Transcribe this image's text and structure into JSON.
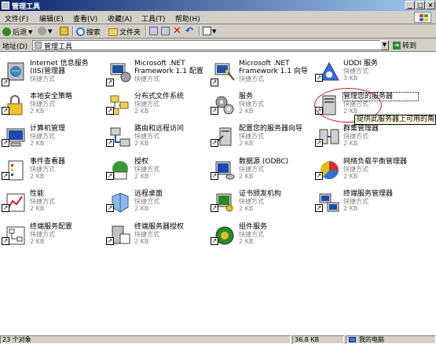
{
  "window": {
    "title": "管理工具"
  },
  "title_buttons": {
    "minimize": "_",
    "maximize": "□",
    "close": "×"
  },
  "menu": [
    {
      "label": "文件(F)"
    },
    {
      "label": "编辑(E)"
    },
    {
      "label": "查看(V)"
    },
    {
      "label": "收藏(A)"
    },
    {
      "label": "工具(T)"
    },
    {
      "label": "帮助(H)"
    }
  ],
  "toolbar": {
    "back": "后退",
    "search": "搜索",
    "folders": "文件夹"
  },
  "address": {
    "label": "地址(D)",
    "value": "管理工具",
    "go": "转到"
  },
  "items": [
    {
      "name": "Internet 信息服务\n(IIS)管理器",
      "sub1": "快捷方式",
      "sub2": "",
      "icon": "iis-icon"
    },
    {
      "name": "Microsoft .NET\nFramework 1.1 配置",
      "sub1": "快捷方式",
      "sub2": "",
      "icon": "net-config-icon"
    },
    {
      "name": "Microsoft .NET\nFramework 1.1 向导",
      "sub1": "快捷方式",
      "sub2": "",
      "icon": "net-wizard-icon"
    },
    {
      "name": "UDDI 服务",
      "sub1": "快捷方式",
      "sub2": "3 KB",
      "icon": "uddi-icon"
    },
    {
      "name": "本地安全策略",
      "sub1": "快捷方式",
      "sub2": "2 KB",
      "icon": "local-security-icon"
    },
    {
      "name": "分布式文件系统",
      "sub1": "快捷方式",
      "sub2": "2 KB",
      "icon": "dfs-icon"
    },
    {
      "name": "服务",
      "sub1": "快捷方式",
      "sub2": "2 KB",
      "icon": "services-icon"
    },
    {
      "name": "管理您的服务器",
      "sub1": "快捷方式",
      "sub2": "2 KB",
      "icon": "manage-server-icon"
    },
    {
      "name": "计算机管理",
      "sub1": "快捷方式",
      "sub2": "2 KB",
      "icon": "computer-management-icon"
    },
    {
      "name": "路由和远程访问",
      "sub1": "快捷方式",
      "sub2": "2 KB",
      "icon": "routing-icon"
    },
    {
      "name": "配置您的服务器向导",
      "sub1": "快捷方式",
      "sub2": "2 KB",
      "icon": "configure-server-icon"
    },
    {
      "name": "群集管理器",
      "sub1": "快捷方式",
      "sub2": "2 KB",
      "icon": "cluster-icon"
    },
    {
      "name": "事件查看器",
      "sub1": "快捷方式",
      "sub2": "2 KB",
      "icon": "event-viewer-icon"
    },
    {
      "name": "授权",
      "sub1": "快捷方式",
      "sub2": "2 KB",
      "icon": "licensing-icon"
    },
    {
      "name": "数据源 (ODBC)",
      "sub1": "快捷方式",
      "sub2": "2 KB",
      "icon": "odbc-icon"
    },
    {
      "name": "网络负载平衡管理器",
      "sub1": "快捷方式",
      "sub2": "2 KB",
      "icon": "nlb-icon"
    },
    {
      "name": "性能",
      "sub1": "快捷方式",
      "sub2": "2 KB",
      "icon": "performance-icon"
    },
    {
      "name": "远程桌面",
      "sub1": "快捷方式",
      "sub2": "2 KB",
      "icon": "remote-desktop-icon"
    },
    {
      "name": "证书颁发机构",
      "sub1": "快捷方式",
      "sub2": "2 KB",
      "icon": "certificate-icon"
    },
    {
      "name": "终端服务管理器",
      "sub1": "快捷方式",
      "sub2": "2 KB",
      "icon": "ts-manager-icon"
    },
    {
      "name": "终端服务配置",
      "sub1": "快捷方式",
      "sub2": "2 KB",
      "icon": "ts-config-icon"
    },
    {
      "name": "终端服务器授权",
      "sub1": "快捷方式",
      "sub2": "2 KB",
      "icon": "ts-licensing-icon"
    },
    {
      "name": "组件服务",
      "sub1": "快捷方式",
      "sub2": "2 KB",
      "icon": "component-services-icon"
    }
  ],
  "tooltip": "提供此服务器上可用的角色",
  "status": {
    "objects": "23 个对象",
    "size": "36.8 KB",
    "location": "我的电脑"
  }
}
